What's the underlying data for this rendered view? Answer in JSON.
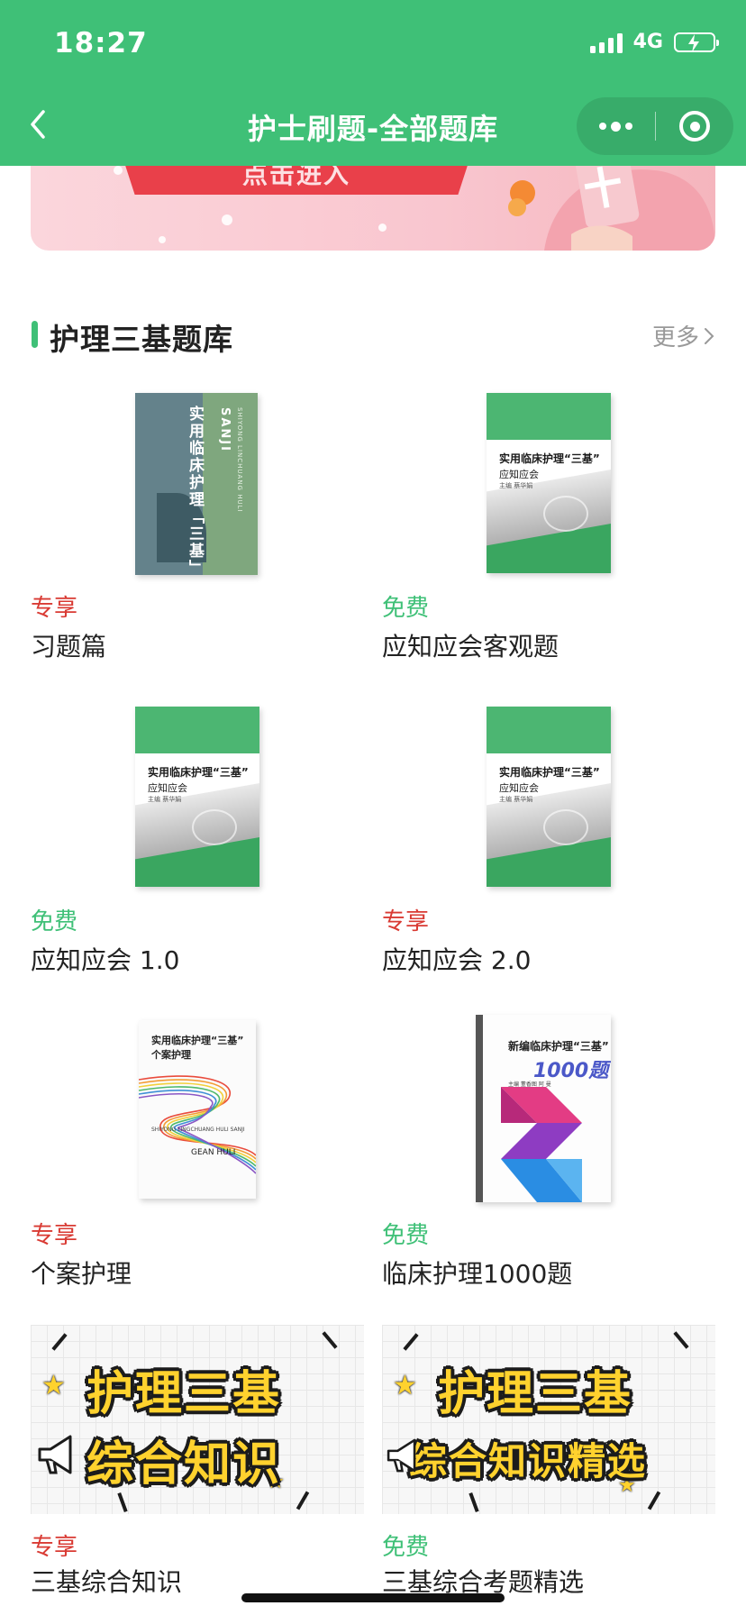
{
  "status_bar": {
    "time": "18:27",
    "network": "4G"
  },
  "nav": {
    "title": "护士刷题-全部题库"
  },
  "banner": {
    "cta": "点击进入"
  },
  "section": {
    "title": "护理三基题库",
    "more": "更多"
  },
  "cards": [
    {
      "tag": "专享",
      "tag_type": "exclusive",
      "name": "习题篇",
      "cover": {
        "style": "slate",
        "title": "实用临床护理「三基」",
        "en": "SANJI",
        "en2": "SHIYONG LINCHUANG HULI"
      }
    },
    {
      "tag": "免费",
      "tag_type": "free",
      "name": "应知应会客观题",
      "cover": {
        "style": "green",
        "title": "实用临床护理“三基”",
        "subtitle": "应知应会",
        "editor": "主编 蔡华娟"
      }
    },
    {
      "tag": "免费",
      "tag_type": "free",
      "name": "应知应会 1.0",
      "cover": {
        "style": "green",
        "title": "实用临床护理“三基”",
        "subtitle": "应知应会",
        "editor": "主编 蔡华娟"
      }
    },
    {
      "tag": "专享",
      "tag_type": "exclusive",
      "name": "应知应会 2.0",
      "cover": {
        "style": "green",
        "title": "实用临床护理“三基”",
        "subtitle": "应知应会",
        "editor": "主编 蔡华娟"
      }
    },
    {
      "tag": "专享",
      "tag_type": "exclusive",
      "name": "个案护理",
      "cover": {
        "style": "white",
        "title": "实用临床护理“三基”",
        "subtitle": "个案护理",
        "en": "SHIYONG LINGCHUANG HULI SANJI",
        "en2": "GEAN HULI"
      }
    },
    {
      "tag": "免费",
      "tag_type": "free",
      "name": "临床护理1000题",
      "cover": {
        "style": "geo",
        "title": "新编临床护理“三基”",
        "subtitle": "1000题",
        "editor": "主编 董香图 阿 曼"
      }
    },
    {
      "tag": "专享",
      "tag_type": "exclusive",
      "name": "三基综合知识",
      "cover": {
        "style": "promo",
        "line1": "护理三基",
        "line2": "综合知识"
      }
    },
    {
      "tag": "免费",
      "tag_type": "free",
      "name": "三基综合考题精选",
      "cover": {
        "style": "promo",
        "line1": "护理三基",
        "line2": "综合知识精选"
      }
    }
  ],
  "colors": {
    "brand_green": "#3fc077",
    "exclusive_red": "#d93a33",
    "free_green": "#3fc077"
  }
}
